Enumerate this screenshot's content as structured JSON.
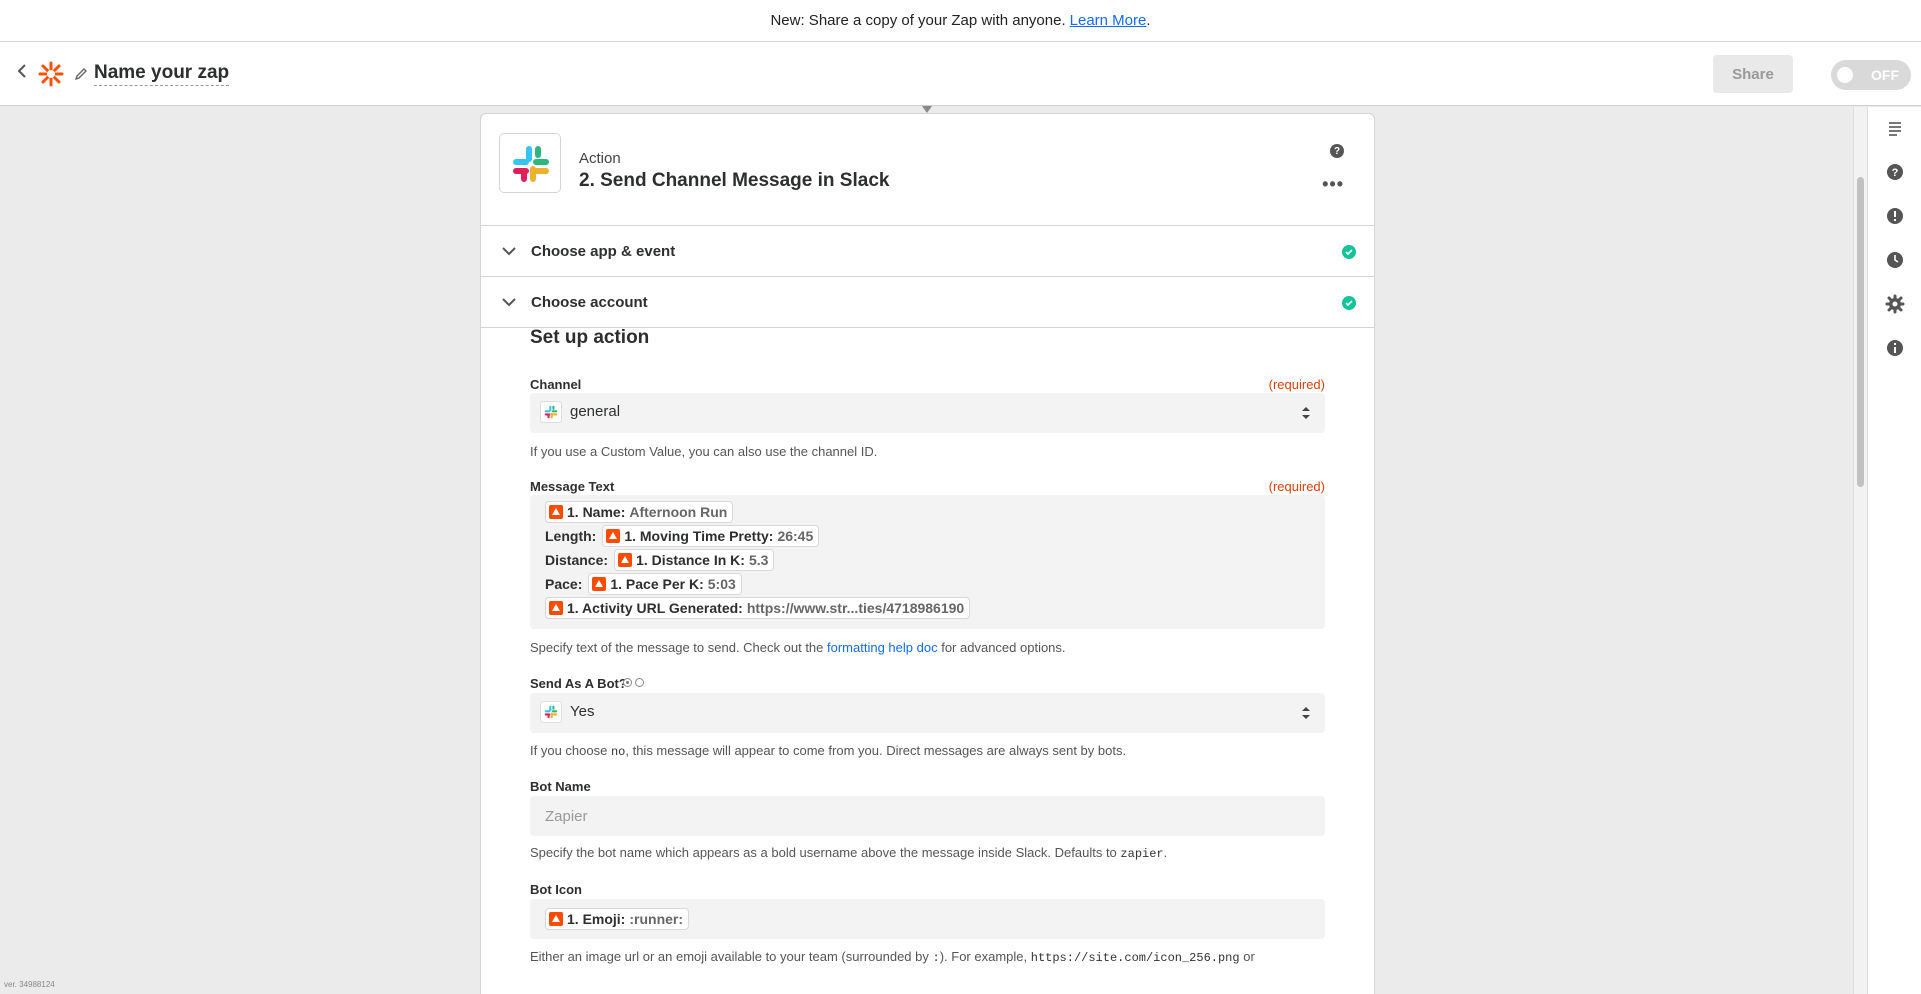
{
  "banner": {
    "text": "New: Share a copy of your Zap with anyone.",
    "link": "Learn More",
    "suffix": "."
  },
  "header": {
    "zap_name": "Name your zap",
    "share_label": "Share",
    "toggle_label": "OFF"
  },
  "step": {
    "type": "Action",
    "title": "2. Send Channel Message in Slack",
    "help_glyph": "?",
    "more_glyph": "•••"
  },
  "accordion": [
    {
      "label": "Choose app & event",
      "complete": true
    },
    {
      "label": "Choose account",
      "complete": true
    }
  ],
  "setup": {
    "title": "Set up action",
    "channel": {
      "label": "Channel",
      "required": "(required)",
      "value": "general",
      "help": "If you use a Custom Value, you can also use the channel ID."
    },
    "message": {
      "label": "Message Text",
      "required": "(required)",
      "lines": [
        {
          "prefix": "",
          "key": "1. Name:",
          "value": "Afternoon Run"
        },
        {
          "prefix": "Length:",
          "key": "1. Moving Time Pretty:",
          "value": "26:45"
        },
        {
          "prefix": "Distance:",
          "key": "1. Distance In K:",
          "value": "5.3"
        },
        {
          "prefix": "Pace:",
          "key": "1. Pace Per K:",
          "value": "5:03"
        },
        {
          "prefix": "",
          "key": "1. Activity URL Generated:",
          "value": "https://www.str...ties/4718986190"
        }
      ],
      "help_pre": "Specify text of the message to send. Check out the",
      "help_link": "formatting help doc",
      "help_post": "for advanced options."
    },
    "bot": {
      "label": "Send As A Bot?",
      "value": "Yes",
      "help_pre": "If you choose",
      "help_code": "no",
      "help_post": ", this message will appear to come from you. Direct messages are always sent by bots."
    },
    "bot_name": {
      "label": "Bot Name",
      "placeholder": "Zapier",
      "help_pre": "Specify the bot name which appears as a bold username above the message inside Slack. Defaults to",
      "help_code": "zapier",
      "help_post": "."
    },
    "bot_icon": {
      "label": "Bot Icon",
      "key": "1. Emoji:",
      "value": ":runner:",
      "help_pre": "Either an image url or an emoji available to your team (surrounded by",
      "help_code": ":",
      "help_mid": "). For example,",
      "help_code2": "https://site.com/icon_256.png",
      "help_post": "or"
    }
  },
  "version": "ver. 34988124",
  "colors": {
    "accent": "#136bf5",
    "required": "#d9410b",
    "check": "#13c39a",
    "zapier": "#ff4f00",
    "strava": "#fc4c02"
  },
  "icons": {
    "rail": [
      "notes-icon",
      "help-icon",
      "alert-icon",
      "history-icon",
      "settings-icon",
      "info-icon"
    ]
  }
}
